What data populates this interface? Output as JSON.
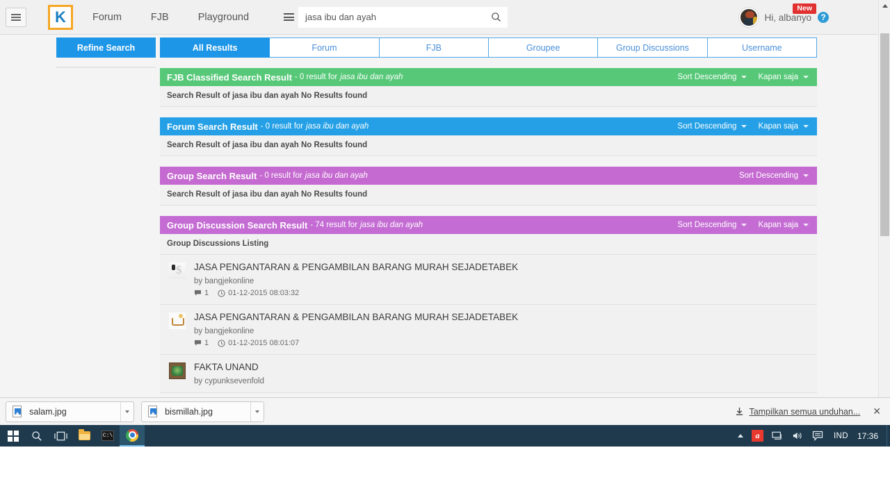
{
  "header": {
    "menu_icon": "hamburger-icon",
    "logo_letter": "K",
    "nav": [
      {
        "label": "Forum"
      },
      {
        "label": "FJB"
      },
      {
        "label": "Playground"
      }
    ],
    "search": {
      "menu_icon": "hamburger-icon",
      "value": "jasa ibu dan ayah",
      "placeholder": "jasa ibu dan ayah",
      "search_icon": "search-icon"
    },
    "user": {
      "greeting": "Hi, albanyo",
      "badge": "New",
      "help_icon": "question-mark-icon",
      "avatar": "user-avatar"
    }
  },
  "sidebar": {
    "refine_label": "Refine Search"
  },
  "tabs": [
    {
      "label": "All Results",
      "active": true
    },
    {
      "label": "Forum",
      "active": false
    },
    {
      "label": "FJB",
      "active": false
    },
    {
      "label": "Groupee",
      "active": false
    },
    {
      "label": "Group Discussions",
      "active": false
    },
    {
      "label": "Username",
      "active": false
    }
  ],
  "blocks": [
    {
      "title": "FJB Classified Search Result",
      "count_text": "- 0 result for",
      "query": "jasa ibu dan ayah",
      "color": "#57c878",
      "sort_label": "Sort Descending",
      "time_label": "Kapan saja",
      "body_text": "Search Result of jasa ibu dan ayah No Results found"
    },
    {
      "title": "Forum Search Result",
      "count_text": "- 0 result for",
      "query": "jasa ibu dan ayah",
      "color": "#25a0e6",
      "sort_label": "Sort Descending",
      "time_label": "Kapan saja",
      "body_text": "Search Result of jasa ibu dan ayah No Results found"
    },
    {
      "title": "Group Search Result",
      "count_text": "- 0 result for",
      "query": "jasa ibu dan ayah",
      "color": "#c56ad0",
      "sort_label": "Sort Descending",
      "time_label": "",
      "body_text": "Search Result of jasa ibu dan ayah No Results found"
    },
    {
      "title": "Group Discussion Search Result",
      "count_text": "- 74 result for",
      "query": "jasa ibu dan ayah",
      "color": "#c46cd3",
      "sort_label": "Sort Descending",
      "time_label": "Kapan saja",
      "body_text": "Group Discussions Listing"
    }
  ],
  "discussions": [
    {
      "title": "JASA PENGANTARAN & PENGAMBILAN BARANG MURAH SEJADETABEK",
      "author": "by bangjekonline",
      "comments": "1",
      "timestamp": "01-12-2015 08:03:32",
      "thumb": "money-person-thumbnail"
    },
    {
      "title": "JASA PENGANTARAN & PENGAMBILAN BARANG MURAH SEJADETABEK",
      "author": "by bangjekonline",
      "comments": "1",
      "timestamp": "01-12-2015 08:01:07",
      "thumb": "shopping-cart-thumbnail"
    },
    {
      "title": "FAKTA UNAND",
      "author": "by cypunksevenfold",
      "comments": "",
      "timestamp": "",
      "thumb": "emblem-thumbnail"
    }
  ],
  "download_shelf": {
    "items": [
      {
        "filename": "salam.jpg",
        "icon": "image-file-icon"
      },
      {
        "filename": "bismillah.jpg",
        "icon": "image-file-icon"
      }
    ],
    "show_all_label": "Tampilkan semua unduhan...",
    "download_icon": "download-arrow-icon",
    "close_label": "✕"
  },
  "taskbar": {
    "start_icon": "windows-start-icon",
    "buttons": [
      {
        "name": "search-icon"
      },
      {
        "name": "task-view-icon"
      },
      {
        "name": "file-explorer-icon"
      },
      {
        "name": "command-prompt-icon"
      },
      {
        "name": "chrome-icon"
      }
    ],
    "tray": {
      "overflow_icon": "chevron-up-icon",
      "avast_letter": "a",
      "network_icon": "network-icon",
      "volume_icon": "volume-icon",
      "action_center_icon": "action-center-icon",
      "language": "IND",
      "clock": "17:36"
    }
  }
}
